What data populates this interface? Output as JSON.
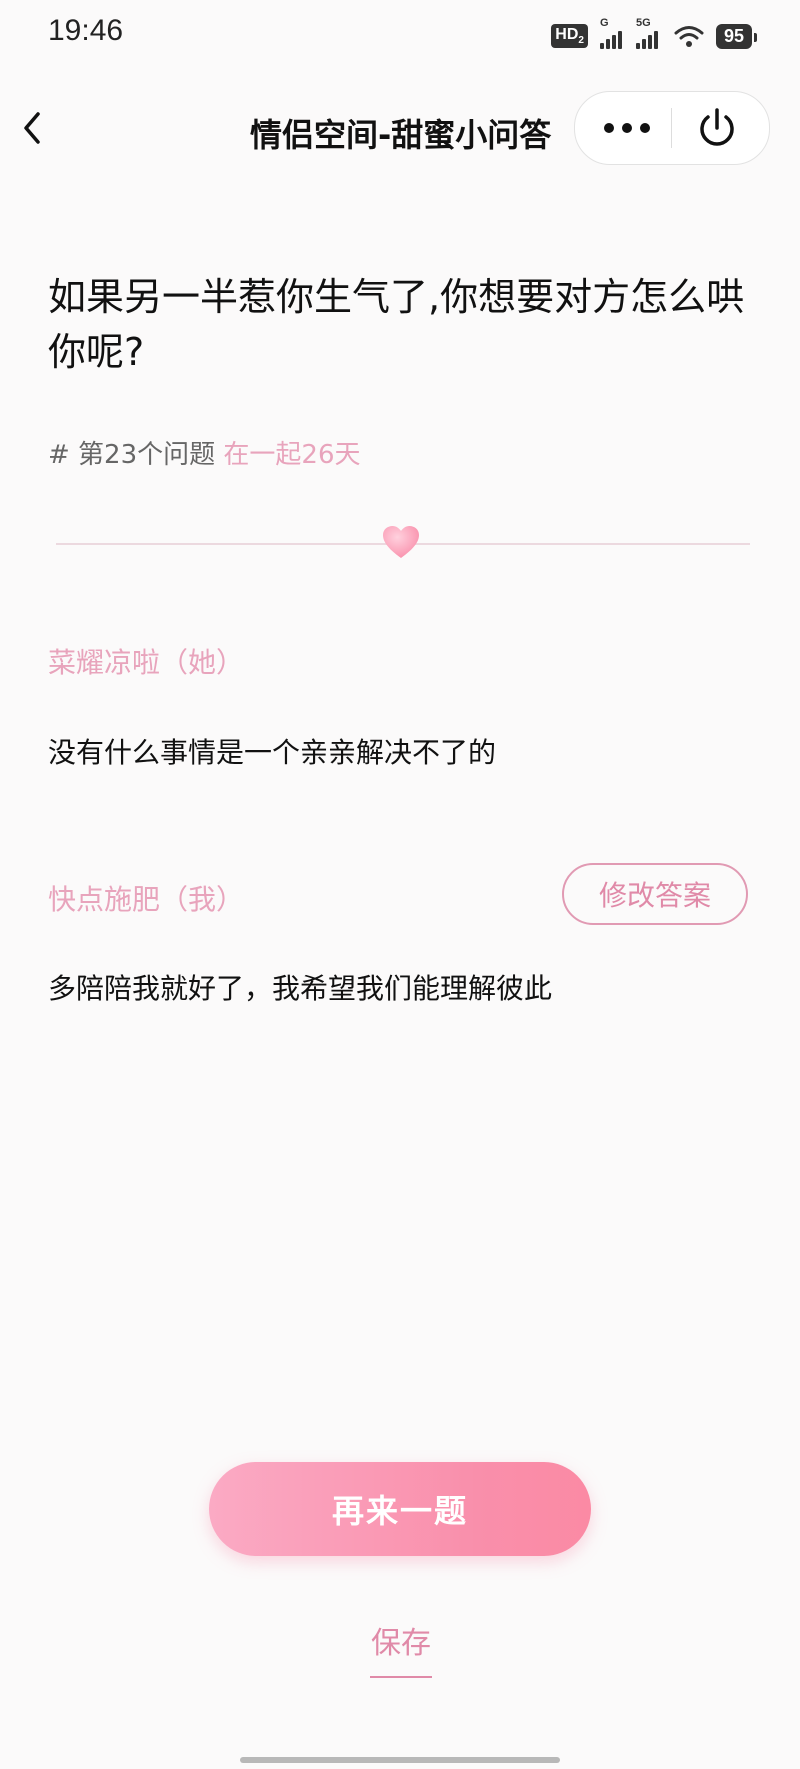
{
  "status_bar": {
    "time": "19:46",
    "hd_label": "HD",
    "hd_sub": "2",
    "signal1_label": "G",
    "signal2_label": "5G",
    "wifi_icon": "wifi-icon",
    "battery": "95"
  },
  "nav": {
    "back_icon": "chevron-left-icon",
    "title": "情侣空间-甜蜜小问答",
    "more_icon": "more-dots-icon",
    "power_icon": "power-icon"
  },
  "question": {
    "text": "如果另一半惹你生气了,你想要对方怎么哄你呢?",
    "number_label": "# 第23个问题",
    "days_label": "在一起26天"
  },
  "answers": [
    {
      "author": "菜耀凉啦（她）",
      "text": "没有什么事情是一个亲亲解决不了的"
    },
    {
      "author": "快点施肥（我）",
      "text": "多陪陪我就好了，我希望我们能理解彼此"
    }
  ],
  "buttons": {
    "edit_answer": "修改答案",
    "next_question": "再来一题",
    "save": "保存"
  },
  "colors": {
    "accent_pink": "#e08aa8",
    "label_pink": "#e8a4bc",
    "button_gradient_start": "#fbaac4",
    "button_gradient_end": "#fb8aa4"
  }
}
